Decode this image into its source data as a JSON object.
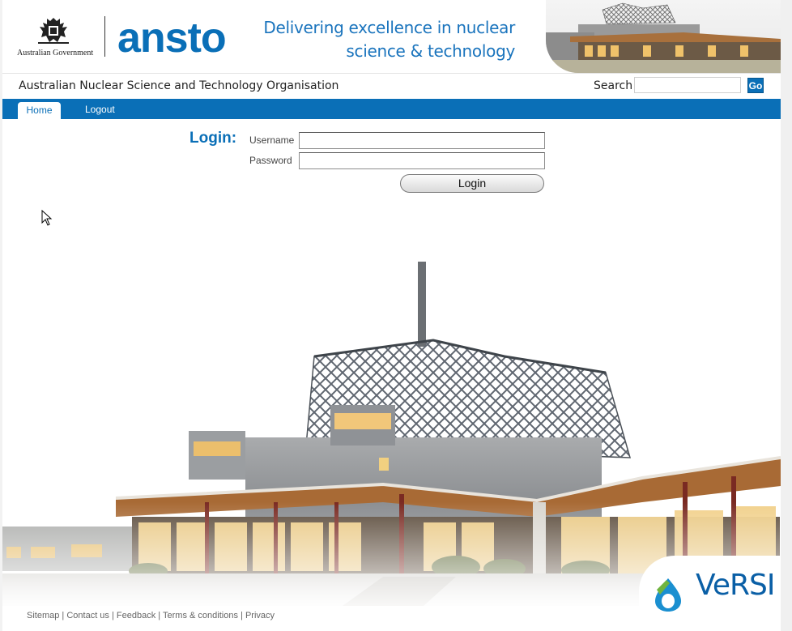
{
  "header": {
    "govt_label": "Australian Government",
    "logo_text": "ansto",
    "tagline_line1": "Delivering excellence in nuclear",
    "tagline_line2": "science & technology",
    "org_name": "Australian Nuclear Science and Technology Organisation",
    "search_label": "Search",
    "search_value": "",
    "go_label": "Go"
  },
  "nav": {
    "items": [
      {
        "label": "Home",
        "active": true
      },
      {
        "label": "Logout",
        "active": false
      }
    ]
  },
  "login": {
    "title": "Login:",
    "username_label": "Username",
    "username_value": "",
    "password_label": "Password",
    "password_value": "",
    "button_label": "Login"
  },
  "footer": {
    "links": [
      "Sitemap",
      "Contact us",
      "Feedback",
      "Terms & conditions",
      "Privacy"
    ]
  },
  "versi": {
    "logo_text": "VeRSI"
  },
  "colors": {
    "brand_blue": "#0a6fb7",
    "nav_bg": "#0a6fb7"
  }
}
